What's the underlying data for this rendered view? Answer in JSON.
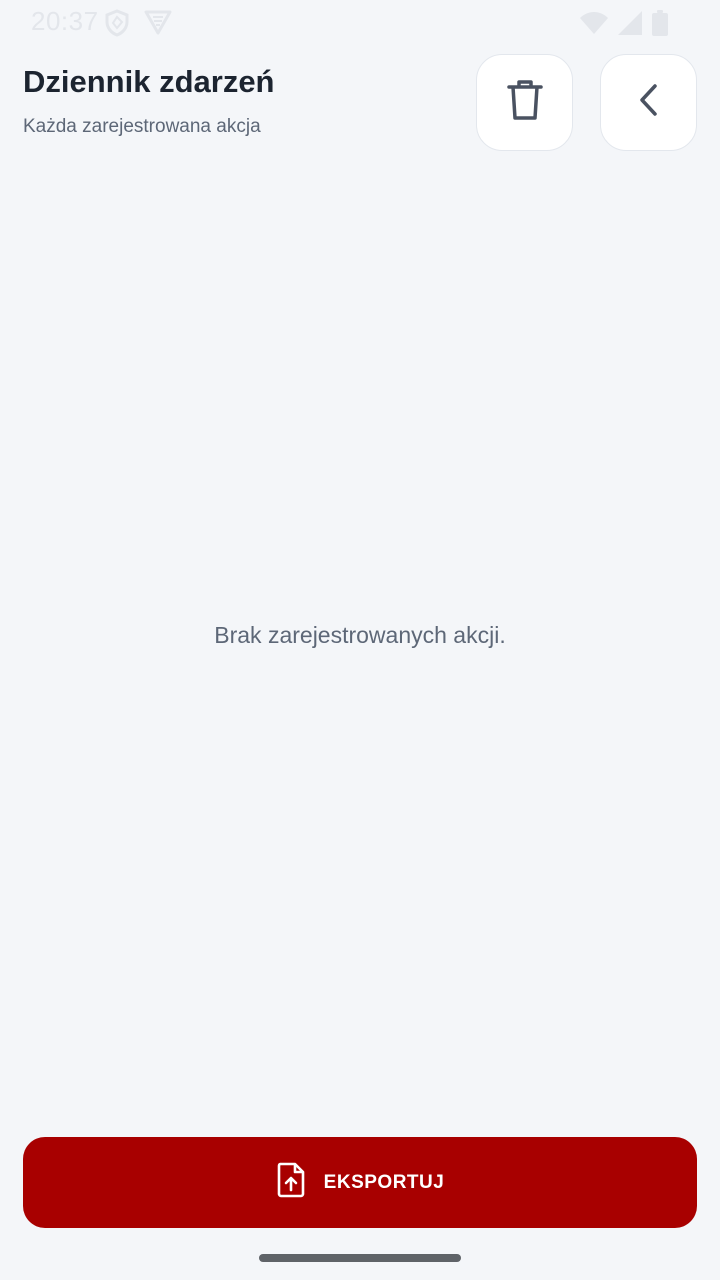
{
  "status_bar": {
    "time": "20:37",
    "left_icons": [
      "shield-icon",
      "vpn-icon"
    ],
    "right_icons": [
      "wifi-icon",
      "signal-icon",
      "battery-icon"
    ]
  },
  "header": {
    "title": "Dziennik zdarzeń",
    "subtitle": "Każda zarejestrowana akcja",
    "delete_icon": "trash-icon",
    "back_icon": "chevron-left-icon"
  },
  "content": {
    "empty_message": "Brak zarejestrowanych akcji."
  },
  "footer": {
    "export_label": "EKSPORTUJ",
    "export_icon": "file-upload-icon"
  },
  "colors": {
    "background": "#f4f6f9",
    "accent": "#a80000",
    "title": "#1c2430",
    "muted_text": "#5d6777"
  }
}
